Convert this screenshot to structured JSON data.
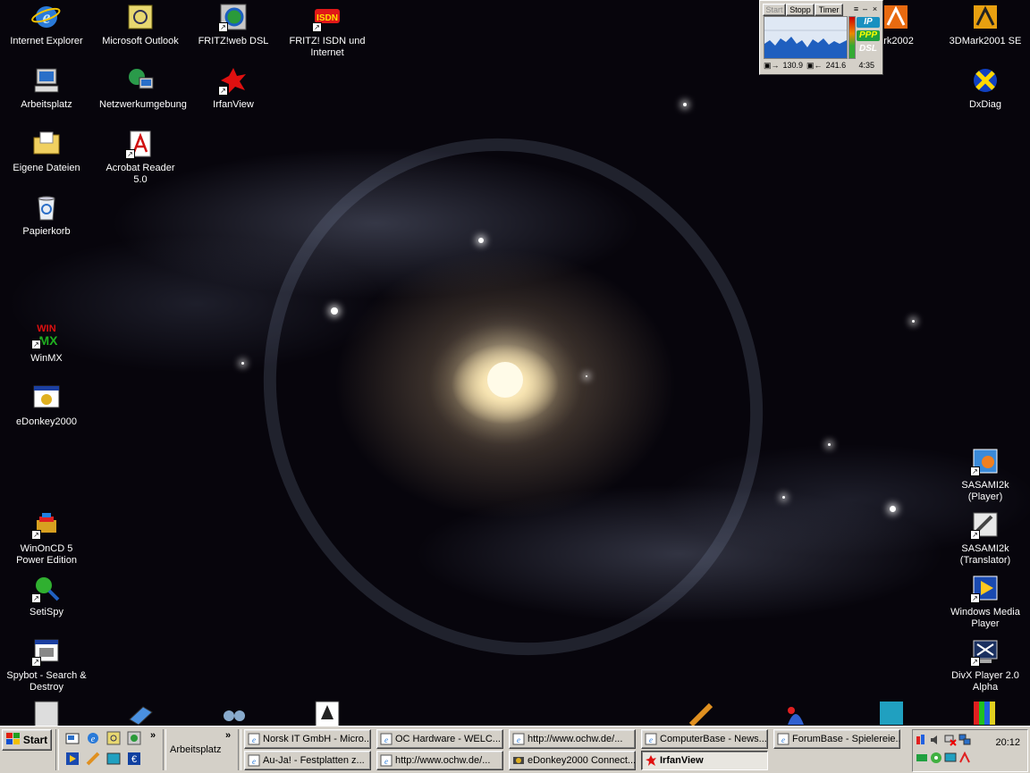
{
  "desktop": {
    "icons_left": [
      {
        "label": "Internet Explorer",
        "icon": "internet-explorer-icon"
      },
      {
        "label": "Microsoft Outlook",
        "icon": "outlook-icon"
      },
      {
        "label": "FRITZ!web DSL",
        "icon": "fritz-web-dsl-icon"
      },
      {
        "label": "FRITZ! ISDN und Internet",
        "icon": "fritz-isdn-icon"
      },
      {
        "label": "Arbeitsplatz",
        "icon": "my-computer-icon"
      },
      {
        "label": "Netzwerkumgebung",
        "icon": "network-icon"
      },
      {
        "label": "IrfanView",
        "icon": "irfanview-icon"
      },
      {
        "label": "Eigene Dateien",
        "icon": "my-documents-icon"
      },
      {
        "label": "Acrobat Reader 5.0",
        "icon": "acrobat-icon"
      },
      {
        "label": "Papierkorb",
        "icon": "recycle-bin-icon"
      },
      {
        "label": "WinMX",
        "icon": "winmx-icon"
      },
      {
        "label": "eDonkey2000",
        "icon": "edonkey-icon"
      },
      {
        "label": "WinOnCD 5 Power Edition",
        "icon": "winoncd-icon"
      },
      {
        "label": "SetiSpy",
        "icon": "setispy-icon"
      },
      {
        "label": "Spybot - Search & Destroy",
        "icon": "spybot-icon"
      }
    ],
    "icons_right": [
      {
        "label": "ark2002",
        "icon": "3dmark-icon"
      },
      {
        "label": "3DMark2001 SE",
        "icon": "3dmark2001-icon"
      },
      {
        "label": "DxDiag",
        "icon": "dxdiag-icon"
      },
      {
        "label": "SASAMI2k (Player)",
        "icon": "sasami-player-icon"
      },
      {
        "label": "SASAMI2k (Translator)",
        "icon": "sasami-translator-icon"
      },
      {
        "label": "Windows Media Player",
        "icon": "media-player-icon"
      },
      {
        "label": "DivX Player 2.0 Alpha",
        "icon": "divx-icon"
      }
    ]
  },
  "fritz_widget": {
    "start_label": "Start",
    "stop_label": "Stopp",
    "timer_label": "Timer",
    "ip_label": "IP",
    "ppp_label": "PPP",
    "dsl_label": "DSL",
    "upload": "130.9",
    "download": "241.6",
    "time": "4:35"
  },
  "taskbar": {
    "start_label": "Start",
    "toolbar_label": "Arbeitsplatz",
    "chevron": "»",
    "tasks": [
      {
        "label": "Norsk IT GmbH - Micro...",
        "icon": "ie-page-icon",
        "active": false
      },
      {
        "label": "OC Hardware - WELC...",
        "icon": "ie-page-icon",
        "active": false
      },
      {
        "label": "http://www.ochw.de/...",
        "icon": "ie-page-icon",
        "active": false
      },
      {
        "label": "ComputerBase - News...",
        "icon": "ie-page-icon",
        "active": false
      },
      {
        "label": "ForumBase - Spielereie...",
        "icon": "ie-page-icon",
        "active": false
      },
      {
        "label": "Au-Ja! - Festplatten z...",
        "icon": "ie-page-icon",
        "active": false
      },
      {
        "label": "http://www.ochw.de/...",
        "icon": "ie-page-icon",
        "active": false
      },
      {
        "label": "eDonkey2000 Connect...",
        "icon": "edonkey-task-icon",
        "active": false
      },
      {
        "label": "IrfanView",
        "icon": "irfanview-task-icon",
        "active": true
      }
    ],
    "clock": "20:12"
  },
  "colors": {
    "desktop_bg": "#07050c",
    "taskbar": "#d4d0c8",
    "graph_fill": "#1f5fbf"
  }
}
